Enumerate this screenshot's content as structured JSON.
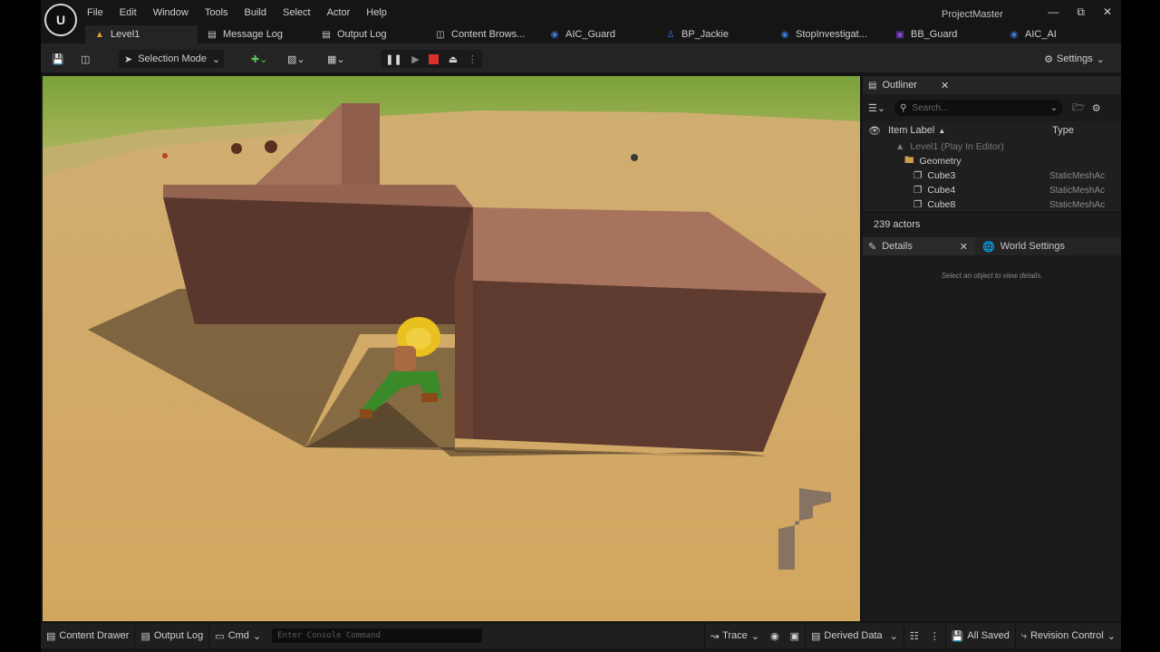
{
  "menu": [
    "File",
    "Edit",
    "Window",
    "Tools",
    "Build",
    "Select",
    "Actor",
    "Help"
  ],
  "project_name": "ProjectMaster",
  "tabs": [
    {
      "label": "Level1",
      "icon": "level-icon",
      "color": "#e3a030"
    },
    {
      "label": "Message Log",
      "icon": "message-log-icon",
      "color": "#cfcfcf"
    },
    {
      "label": "Output Log",
      "icon": "output-log-icon",
      "color": "#cfcfcf"
    },
    {
      "label": "Content Brows...",
      "icon": "content-browser-icon",
      "color": "#cfcfcf"
    },
    {
      "label": "AIC_Guard",
      "icon": "ai-controller-icon",
      "color": "#3a78e0"
    },
    {
      "label": "BP_Jackie",
      "icon": "pawn-icon",
      "color": "#3a78e0"
    },
    {
      "label": "StopInvestigat...",
      "icon": "task-icon",
      "color": "#3a78e0"
    },
    {
      "label": "BB_Guard",
      "icon": "blackboard-icon",
      "color": "#8a4ad8"
    },
    {
      "label": "AIC_AI",
      "icon": "ai-controller-icon",
      "color": "#3a78e0"
    }
  ],
  "toolbar": {
    "selection_mode": "Selection Mode",
    "settings": "Settings"
  },
  "outliner": {
    "title": "Outliner",
    "search_placeholder": "Search...",
    "col_label": "Item Label",
    "col_type": "Type",
    "rows": [
      {
        "label": "Level1 (Play In Editor)",
        "type": "",
        "kind": "level"
      },
      {
        "label": "Geometry",
        "type": "",
        "kind": "folder"
      },
      {
        "label": "Cube3",
        "type": "StaticMeshAc",
        "kind": "mesh"
      },
      {
        "label": "Cube4",
        "type": "StaticMeshAc",
        "kind": "mesh"
      },
      {
        "label": "Cube8",
        "type": "StaticMeshAc",
        "kind": "mesh"
      }
    ],
    "actor_count": "239 actors"
  },
  "details": {
    "tab_details": "Details",
    "tab_world": "World Settings",
    "empty_text": "Select an object to view details."
  },
  "statusbar": {
    "content_drawer": "Content Drawer",
    "output_log": "Output Log",
    "cmd": "Cmd",
    "console_placeholder": "Enter Console Command",
    "trace": "Trace",
    "derived_data": "Derived Data",
    "all_saved": "All Saved",
    "revision_control": "Revision Control"
  },
  "colors": {
    "accent_play": "#d8302c",
    "panel_bg": "#1b1b1b",
    "toolbar_bg": "#242424",
    "ground": "#d0a664",
    "wall": "#8c5a48"
  }
}
